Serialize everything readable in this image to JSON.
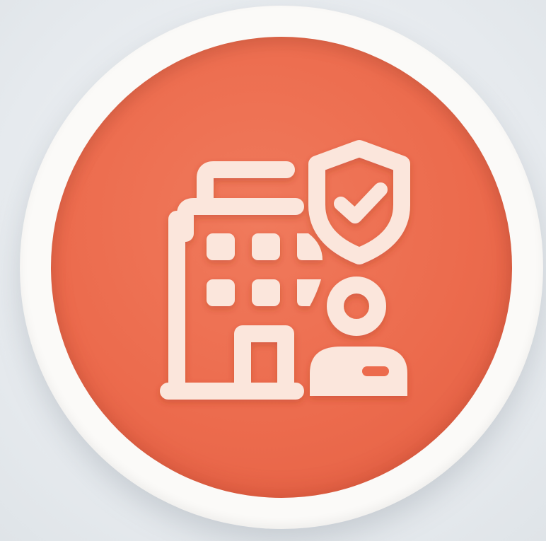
{
  "badge": {
    "icon": "office-building-shield-user-icon",
    "ring_color": "#fbfaf8",
    "disc_color": "#ec6b4d",
    "glyph_color": "#fbe6dc"
  }
}
